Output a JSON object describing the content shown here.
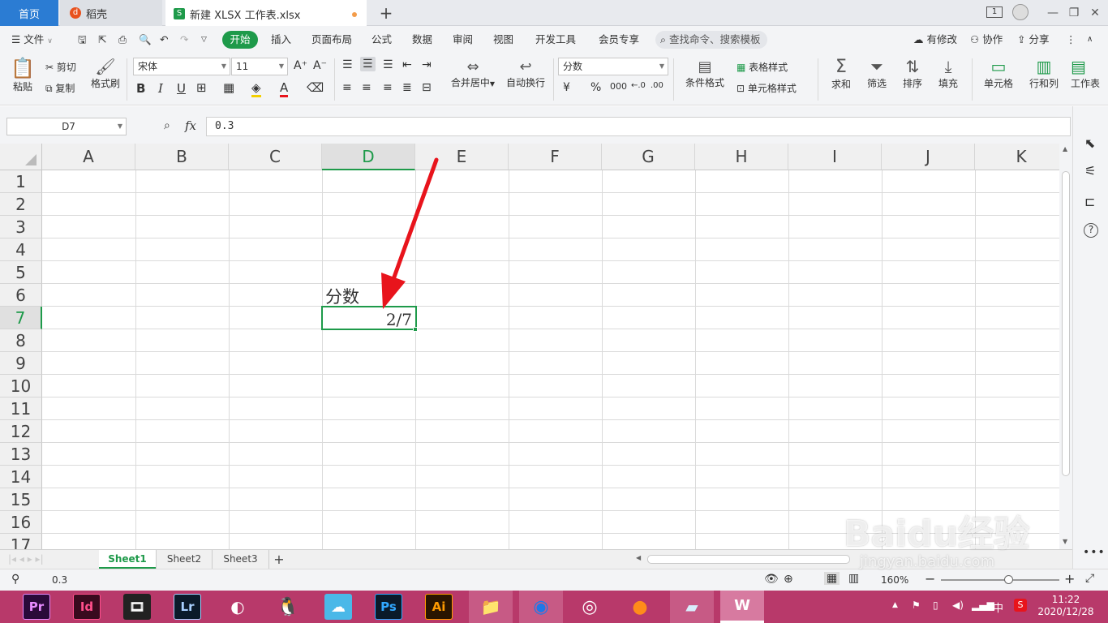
{
  "tabs": {
    "home": "首页",
    "daoke": "稻壳",
    "file": "新建 XLSX 工作表.xlsx",
    "new_tab": "+"
  },
  "window": {
    "badge": "1"
  },
  "menubar": {
    "file": "文件",
    "items": [
      "开始",
      "插入",
      "页面布局",
      "公式",
      "数据",
      "审阅",
      "视图",
      "开发工具",
      "会员专享"
    ],
    "search_placeholder": "查找命令、搜索模板",
    "changes": "有修改",
    "collab": "协作",
    "share": "分享"
  },
  "ribbon": {
    "paste": "粘贴",
    "cut": "剪切",
    "copy": "复制",
    "format_painter": "格式刷",
    "font_name": "宋体",
    "font_size": "11",
    "merge_center": "合并居中",
    "wrap_text": "自动换行",
    "number_format": "分数",
    "cond_format": "条件格式",
    "table_style": "表格样式",
    "cell_style": "单元格样式",
    "sum": "求和",
    "filter": "筛选",
    "sort": "排序",
    "fill": "填充",
    "cell": "单元格",
    "row_col": "行和列",
    "worksheet": "工作表"
  },
  "formula_bar": {
    "cell_ref": "D7",
    "fx": "fx",
    "value": "0.3"
  },
  "grid": {
    "columns": [
      "A",
      "B",
      "C",
      "D",
      "E",
      "F",
      "G",
      "H",
      "I",
      "J",
      "K"
    ],
    "rows": [
      "1",
      "2",
      "3",
      "4",
      "5",
      "6",
      "7",
      "8",
      "9",
      "10",
      "11",
      "12",
      "13",
      "14",
      "15",
      "16",
      "17"
    ],
    "selected_col": "D",
    "selected_row": "7",
    "cells": {
      "D6": "分数",
      "D7": "2/7"
    }
  },
  "sheet_tabs": [
    "Sheet1",
    "Sheet2",
    "Sheet3"
  ],
  "active_sheet": "Sheet1",
  "status": {
    "value": "0.3",
    "zoom": "160%"
  },
  "taskbar": {
    "apps": [
      "Pr",
      "Id",
      "",
      "Lr",
      "",
      "",
      "",
      "Ps",
      "Ai",
      "",
      "",
      "",
      "",
      "",
      ""
    ],
    "time": "11:22",
    "date": "2020/12/28",
    "ime": "中"
  },
  "watermark": {
    "text": "Baidu经验",
    "url": "jingyan.baidu.com"
  },
  "colors": {
    "accent_green": "#1e9a4a",
    "arrow_red": "#e8141c",
    "taskbar": "#b8396a"
  }
}
